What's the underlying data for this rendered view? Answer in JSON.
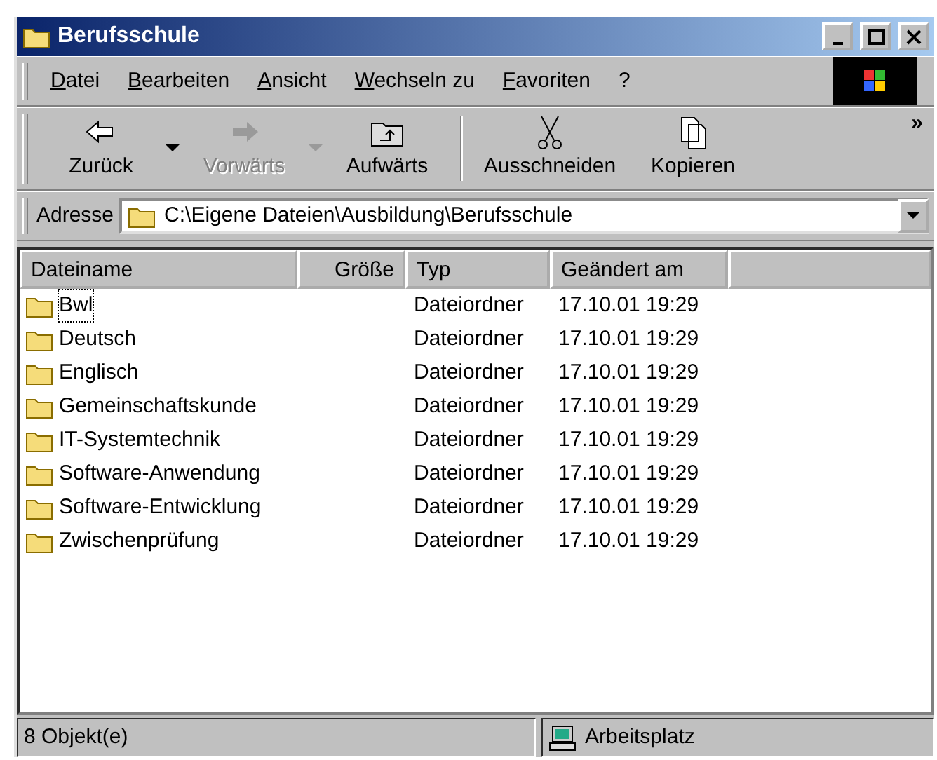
{
  "window": {
    "title": "Berufsschule"
  },
  "menu": [
    "Datei",
    "Bearbeiten",
    "Ansicht",
    "Wechseln zu",
    "Favoriten",
    "?"
  ],
  "toolbar": [
    {
      "label": "Zurück",
      "kind": "back",
      "disabled": false,
      "dropdown": true
    },
    {
      "label": "Vorwärts",
      "kind": "forward",
      "disabled": true,
      "dropdown": true
    },
    {
      "label": "Aufwärts",
      "kind": "up",
      "disabled": false,
      "dropdown": false
    },
    {
      "label": "Ausschneiden",
      "kind": "cut",
      "disabled": false,
      "dropdown": false
    },
    {
      "label": "Kopieren",
      "kind": "copy",
      "disabled": false,
      "dropdown": false
    }
  ],
  "toolbar_more": "»",
  "address": {
    "label": "Adresse",
    "value": "C:\\Eigene Dateien\\Ausbildung\\Berufsschule"
  },
  "table": {
    "columns": [
      "Dateiname",
      "Größe",
      "Typ",
      "Geändert am"
    ],
    "rows": [
      {
        "name": "Bwl",
        "size": "",
        "type": "Dateiordner",
        "modified": "17.10.01 19:29",
        "focused": true
      },
      {
        "name": "Deutsch",
        "type": "Dateiordner",
        "modified": "17.10.01 19:29",
        "focused": false
      },
      {
        "name": "Englisch",
        "type": "Dateiordner",
        "modified": "17.10.01 19:29",
        "focused": false
      },
      {
        "name": "Gemeinschaftskunde",
        "type": "Dateiordner",
        "modified": "17.10.01 19:29",
        "focused": false
      },
      {
        "name": "IT-Systemtechnik",
        "type": "Dateiordner",
        "modified": "17.10.01 19:29",
        "focused": false
      },
      {
        "name": "Software-Anwendung",
        "type": "Dateiordner",
        "modified": "17.10.01 19:29",
        "focused": false
      },
      {
        "name": "Software-Entwicklung",
        "type": "Dateiordner",
        "modified": "17.10.01 19:29",
        "focused": false
      },
      {
        "name": "Zwischenprüfung",
        "type": "Dateiordner",
        "modified": "17.10.01 19:29",
        "focused": false
      }
    ]
  },
  "status_bar": {
    "count": "8 Objekt(e)",
    "location": "Arbeitsplatz"
  }
}
